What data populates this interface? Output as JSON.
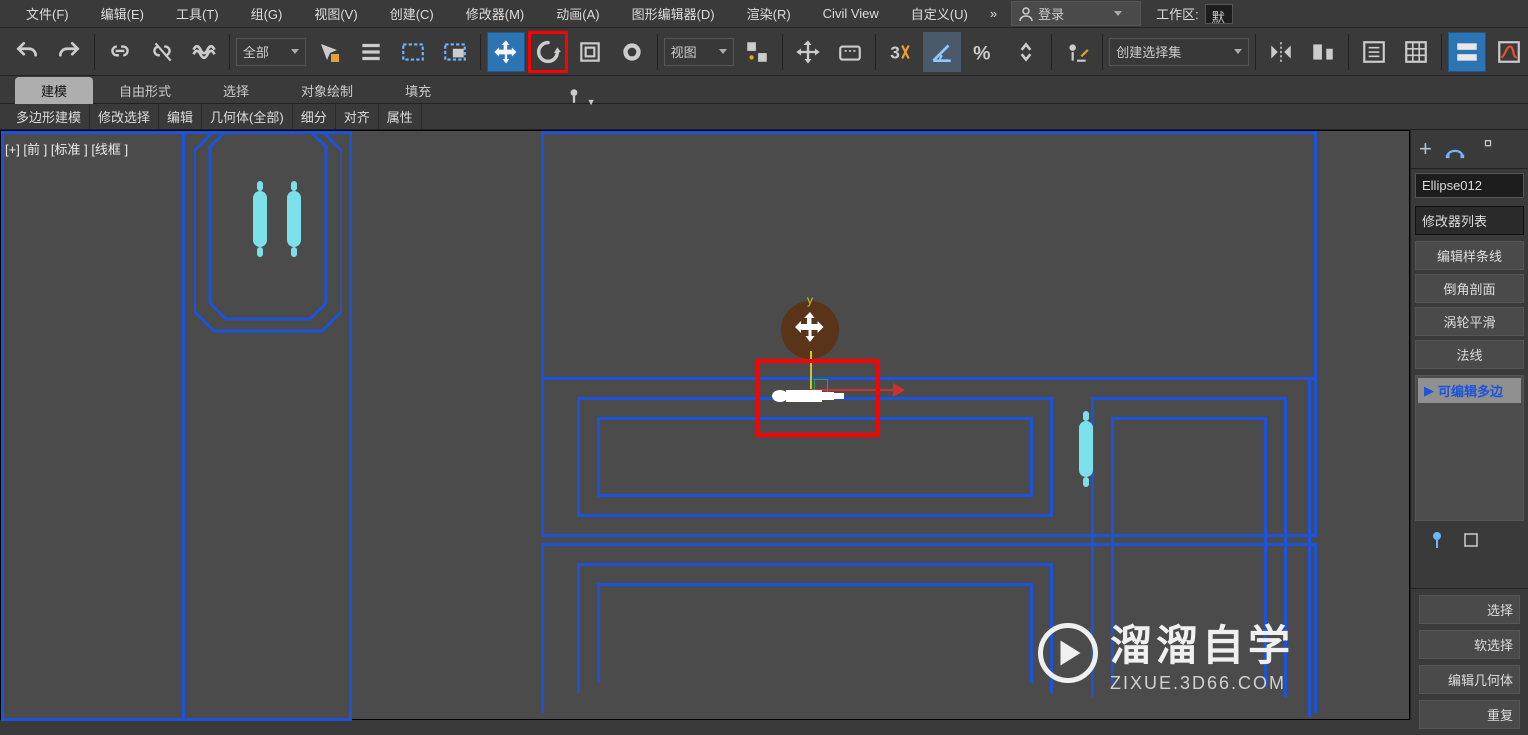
{
  "menu": {
    "file": "文件(F)",
    "edit": "编辑(E)",
    "tools": "工具(T)",
    "group": "组(G)",
    "views": "视图(V)",
    "create": "创建(C)",
    "modifier": "修改器(M)",
    "animation": "动画(A)",
    "graph": "图形编辑器(D)",
    "render": "渲染(R)",
    "civilview": "Civil View",
    "customize": "自定义(U)",
    "more": "»",
    "login": "登录",
    "workspace_label": "工作区:",
    "workspace_value": "默"
  },
  "toolbar": {
    "all_dropdown": "全部",
    "view_dropdown": "视图",
    "selection_set": "创建选择集"
  },
  "ribbon": {
    "tabs": {
      "modeling": "建模",
      "freeform": "自由形式",
      "selection": "选择",
      "object_paint": "对象绘制",
      "populate": "填充"
    },
    "sub": {
      "poly_modeling": "多边形建模",
      "modify_sel": "修改选择",
      "edit": "编辑",
      "geom_all": "几何体(全部)",
      "subdiv": "细分",
      "align": "对齐",
      "properties": "属性"
    }
  },
  "viewport": {
    "label": "[+] [前 ] [标准 ] [线框 ]",
    "gizmo_y": "y"
  },
  "right_panel": {
    "object_name": "Ellipse012",
    "modifier_list": "修改器列表",
    "edit_spline": "编辑样条线",
    "chamfer_profile": "倒角剖面",
    "turbo_smooth": "涡轮平滑",
    "normal": "法线",
    "editable_poly": "可编辑多边",
    "selection_title": "选择",
    "soft_sel": "软选择",
    "edit_geom": "编辑几何体",
    "reset": "重复"
  },
  "logo": {
    "cn": "溜溜自学",
    "en": "ZIXUE.3D66.COM"
  }
}
